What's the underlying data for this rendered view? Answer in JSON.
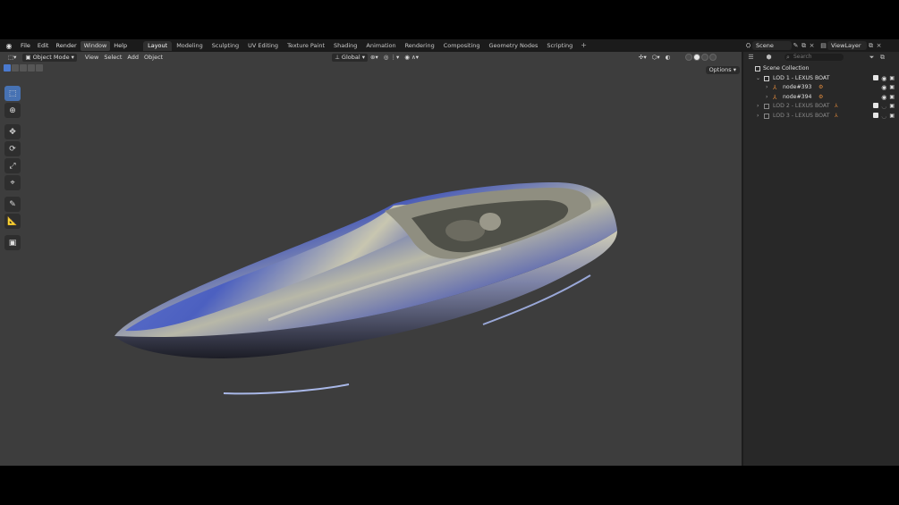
{
  "menu": [
    "File",
    "Edit",
    "Render",
    "Window",
    "Help"
  ],
  "menu_active": "Window",
  "workspaces": [
    "Layout",
    "Modeling",
    "Sculpting",
    "UV Editing",
    "Texture Paint",
    "Shading",
    "Animation",
    "Rendering",
    "Compositing",
    "Geometry Nodes",
    "Scripting"
  ],
  "workspace_active": "Layout",
  "scene": {
    "label": "Scene",
    "viewlayer": "ViewLayer"
  },
  "viewport": {
    "mode": "Object Mode",
    "header_menu": [
      "View",
      "Select",
      "Add",
      "Object"
    ],
    "transform_orientation": "Global",
    "options_label": "Options"
  },
  "tools": [
    "select-box",
    "cursor",
    "move",
    "rotate",
    "scale",
    "transform",
    "annotate",
    "measure",
    "add-cube"
  ],
  "outliner": {
    "search_placeholder": "Search",
    "root": "Scene Collection",
    "items": [
      {
        "label": "LOD 1 - LEXUS BOAT",
        "dim": false
      },
      {
        "label": "node#393",
        "dim": false
      },
      {
        "label": "node#394",
        "dim": false
      },
      {
        "label": "LOD 2 - LEXUS BOAT",
        "dim": true
      },
      {
        "label": "LOD 3 - LEXUS BOAT",
        "dim": true
      }
    ]
  },
  "colors": {
    "accent": "#4772b3",
    "object_orange": "#e08a3c"
  }
}
